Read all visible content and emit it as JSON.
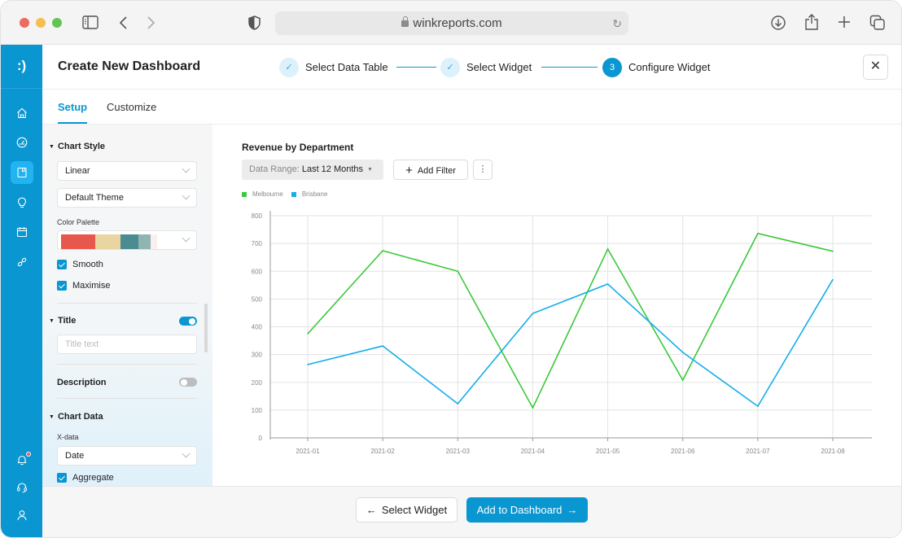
{
  "browser": {
    "url": "winkreports.com",
    "icons": [
      "sidebar-toggle-icon",
      "back-icon",
      "forward-icon",
      "shield-icon",
      "reload-icon",
      "download-icon",
      "share-icon",
      "new-tab-icon",
      "tabs-overview-icon"
    ]
  },
  "nav": {
    "logo": ":)",
    "items": [
      {
        "name": "home",
        "icon": "home-icon"
      },
      {
        "name": "dashboard",
        "icon": "gauge-icon"
      },
      {
        "name": "reports",
        "icon": "report-icon",
        "active": true
      },
      {
        "name": "insights",
        "icon": "lightbulb-icon"
      },
      {
        "name": "calendar",
        "icon": "calendar-icon"
      },
      {
        "name": "integrations",
        "icon": "link-icon"
      }
    ],
    "bottom_items": [
      {
        "name": "notifications",
        "icon": "bell-icon",
        "badge": true
      },
      {
        "name": "support",
        "icon": "headset-icon"
      },
      {
        "name": "profile",
        "icon": "user-icon"
      }
    ]
  },
  "header": {
    "title": "Create New Dashboard",
    "steps": [
      {
        "label": "Select Data Table",
        "state": "done",
        "marker": "✓"
      },
      {
        "label": "Select Widget",
        "state": "done",
        "marker": "✓"
      },
      {
        "label": "Configure Widget",
        "state": "current",
        "marker": "3"
      }
    ],
    "close_label": "✕"
  },
  "tabs": [
    {
      "label": "Setup",
      "active": true
    },
    {
      "label": "Customize",
      "active": false
    }
  ],
  "panel": {
    "chart_style": {
      "heading": "Chart Style",
      "type_select": "Linear",
      "theme_select": "Default Theme",
      "palette_label": "Color Palette",
      "palette_colors": [
        "#e8574c",
        "#e8d5a0",
        "#4a8c91",
        "#8fb5b0",
        "#fdeeee"
      ],
      "smooth_label": "Smooth",
      "smooth_checked": true,
      "maximise_label": "Maximise",
      "maximise_checked": true
    },
    "title": {
      "heading": "Title",
      "enabled": true,
      "input_value": "",
      "input_placeholder": "Title text"
    },
    "description": {
      "heading": "Description",
      "enabled": false
    },
    "chart_data": {
      "heading": "Chart Data",
      "x_label": "X-data",
      "x_select": "Date",
      "aggregate_label": "Aggregate",
      "aggregate_checked": true
    }
  },
  "main": {
    "chart_title": "Revenue by Department",
    "range_prefix": "Data Range:",
    "range_value": "Last 12 Months",
    "add_filter_label": "Add Filter",
    "more_label": "⋮"
  },
  "chart_data": {
    "type": "line",
    "title": "Revenue by Department",
    "xlabel": "",
    "ylabel": "",
    "categories": [
      "2021-01",
      "2021-02",
      "2021-03",
      "2021-04",
      "2021-05",
      "2021-06",
      "2021-07",
      "2021-08"
    ],
    "series": [
      {
        "name": "Melbourne",
        "color": "#3cc83c",
        "values": [
          375,
          674,
          600,
          108,
          680,
          208,
          736,
          672
        ]
      },
      {
        "name": "Brisbane",
        "color": "#14aeea",
        "values": [
          264,
          331,
          123,
          448,
          554,
          308,
          114,
          570
        ]
      }
    ],
    "ylim": [
      0,
      800
    ],
    "yticks": [
      0,
      100,
      200,
      300,
      400,
      500,
      600,
      700,
      800
    ],
    "grid": true,
    "legend_position": "top-left"
  },
  "footer": {
    "back_label": "Select Widget",
    "next_label": "Add to Dashboard"
  }
}
